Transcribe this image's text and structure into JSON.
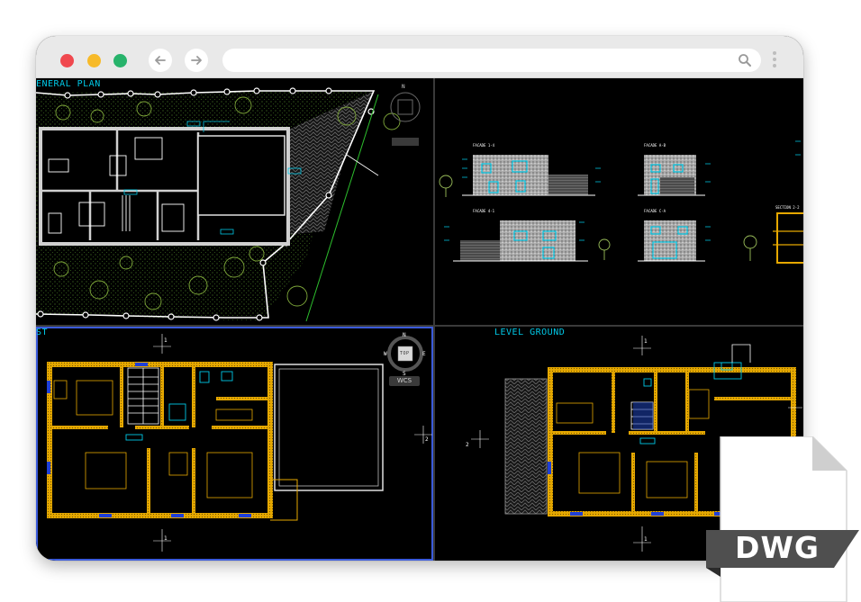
{
  "browser": {
    "address_value": "",
    "colors": {
      "close": "#f0484e",
      "minimize": "#f7ba29",
      "maximize": "#27b36b"
    },
    "icons": {
      "back": "arrow-left-icon",
      "forward": "arrow-right-icon",
      "search": "search-icon",
      "menu": "kebab-menu-icon"
    }
  },
  "viewports": {
    "general_plan": {
      "title": "ENERAL PLAN",
      "compass_n": "N"
    },
    "facades": {
      "labels": [
        "FACADE 1-4",
        "FACADE A-B",
        "FACADE 4-1",
        "FACADE C-A",
        "SECTION 2-2"
      ]
    },
    "first": {
      "title": "ST",
      "viewcube": {
        "n": "N",
        "s": "S",
        "e": "E",
        "w": "W",
        "face": "TOP"
      },
      "wcs": "WCS",
      "marker_1": "1",
      "marker_2": "2"
    },
    "ground": {
      "title": "LEVEL GROUND",
      "marker_1": "1",
      "marker_2": "2"
    }
  },
  "file_badge": {
    "label": "DWG"
  }
}
